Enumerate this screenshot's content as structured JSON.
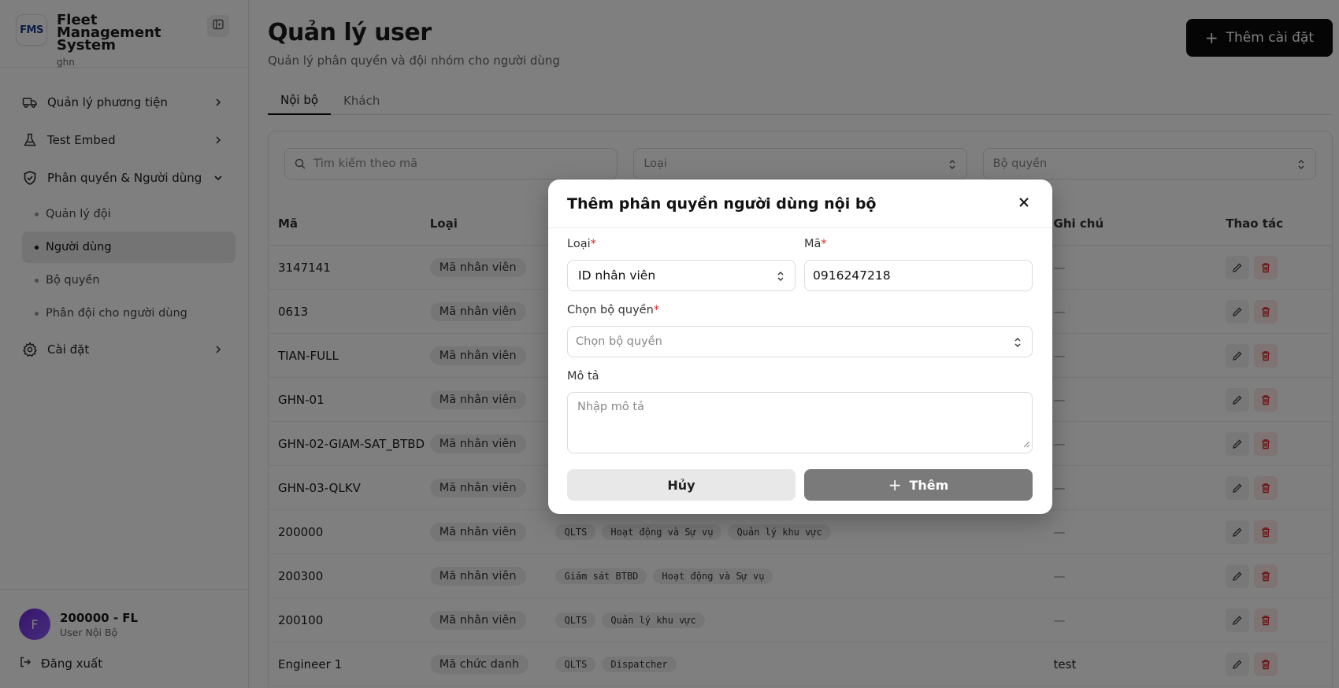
{
  "sidebar": {
    "logo_text": "FMS",
    "title": "Fleet Management System",
    "subtitle": "ghn",
    "nav": [
      {
        "label": "Quản lý phương tiện",
        "icon": "truck-icon"
      },
      {
        "label": "Test Embed",
        "icon": "flask-icon"
      },
      {
        "label": "Phân quyền & Người dùng",
        "icon": "shield-check-icon"
      },
      {
        "label": "Cài đặt",
        "icon": "gear-icon"
      }
    ],
    "sub_items": [
      {
        "label": "Quản lý đội",
        "active": false
      },
      {
        "label": "Người dùng",
        "active": true
      },
      {
        "label": "Bộ quyền",
        "active": false
      },
      {
        "label": "Phân đội cho người dùng",
        "active": false
      }
    ],
    "user": {
      "initial": "F",
      "name": "200000 - FL",
      "role": "User Nội Bộ"
    },
    "logout_label": "Đăng xuất"
  },
  "main": {
    "title": "Quản lý user",
    "subtitle": "Quản lý phân quyền và đội nhóm cho người dùng",
    "add_button": "Thêm cài đặt",
    "tabs": [
      "Nội bộ",
      "Khách"
    ],
    "filters": {
      "search_placeholder": "Tìm kiếm theo mã",
      "type_placeholder": "Loại",
      "perm_placeholder": "Bộ quyền"
    },
    "columns": [
      "Mã",
      "Loại",
      "Ghi chú",
      "Thao tác"
    ],
    "rows": [
      {
        "code": "3147141",
        "type": "Mã nhân viên",
        "chips": [],
        "note": "—"
      },
      {
        "code": "0613",
        "type": "Mã nhân viên",
        "chips": [],
        "note": "—"
      },
      {
        "code": "TIAN-FULL",
        "type": "Mã nhân viên",
        "chips": [],
        "note": "—"
      },
      {
        "code": "GHN-01",
        "type": "Mã nhân viên",
        "chips": [],
        "note": "—"
      },
      {
        "code": "GHN-02-GIAM-SAT_BTBD",
        "type": "Mã nhân viên",
        "chips": [],
        "note": "—"
      },
      {
        "code": "GHN-03-QLKV",
        "type": "Mã nhân viên",
        "chips": [],
        "note": "—"
      },
      {
        "code": "200000",
        "type": "Mã nhân viên",
        "chips": [
          "QLTS",
          "Hoạt động và Sự vụ",
          "Quản lý khu vực"
        ],
        "note": "—"
      },
      {
        "code": "200300",
        "type": "Mã nhân viên",
        "chips": [
          "Giám sát BTBD",
          "Hoạt động và Sự vụ"
        ],
        "note": "—"
      },
      {
        "code": "200100",
        "type": "Mã nhân viên",
        "chips": [
          "QLTS",
          "Quản lý khu vực"
        ],
        "note": "—"
      },
      {
        "code": "Engineer 1",
        "type": "Mã chức danh",
        "chips": [
          "QLTS",
          "Dispatcher"
        ],
        "note": "test"
      }
    ]
  },
  "modal": {
    "title": "Thêm phân quyền người dùng nội bộ",
    "type_label": "Loại",
    "type_value": "ID nhân viên",
    "code_label": "Mã",
    "code_value": "0916247218",
    "perm_label": "Chọn bộ quyền",
    "perm_placeholder": "Chọn bộ quyền",
    "desc_label": "Mô tả",
    "desc_placeholder": "Nhập mô tả",
    "required_mark": "*",
    "cancel_label": "Hủy",
    "add_label": "Thêm"
  }
}
